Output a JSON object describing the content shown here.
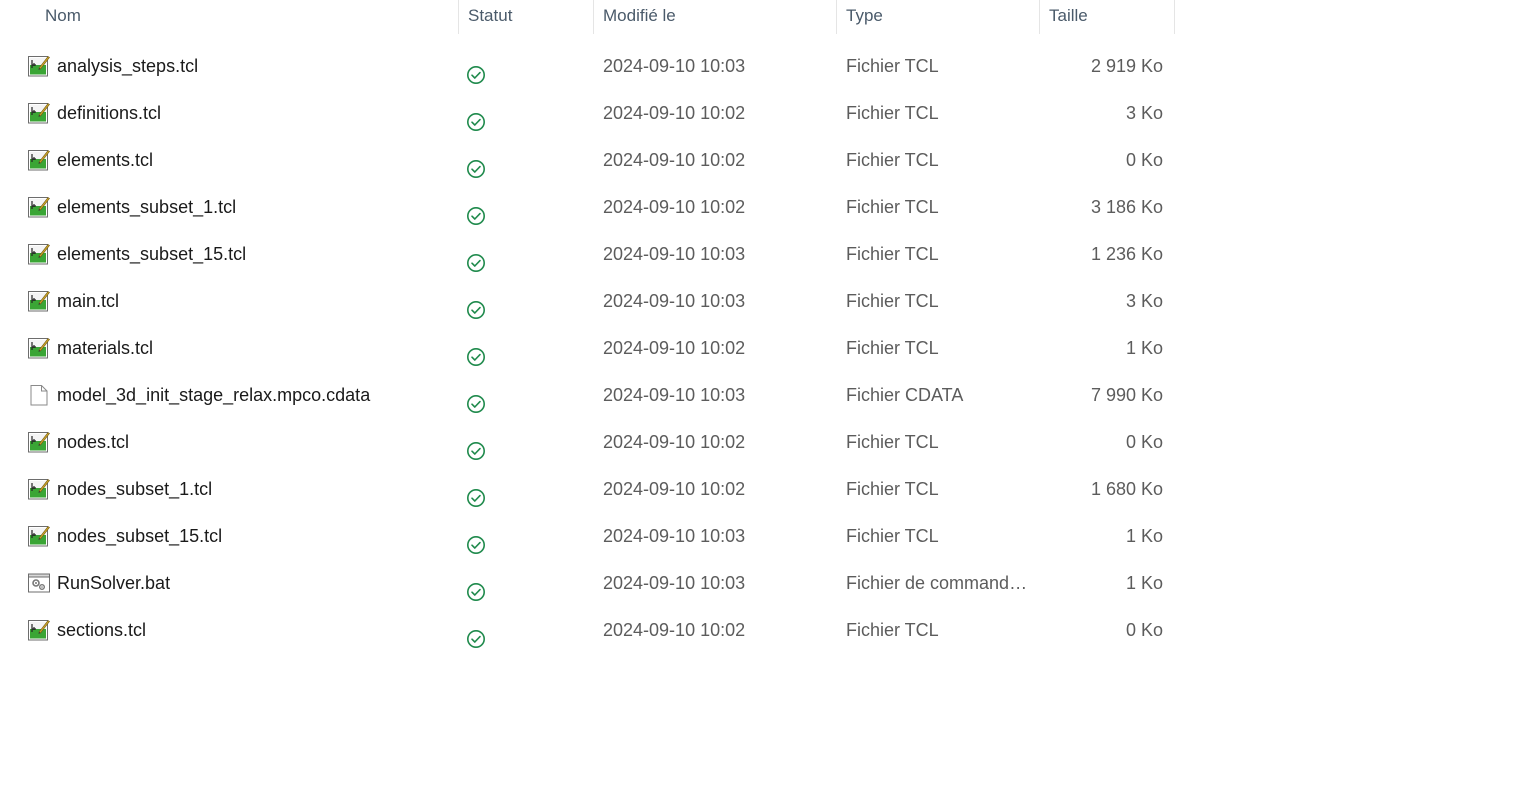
{
  "columns": {
    "name": "Nom",
    "status": "Statut",
    "modified": "Modifié le",
    "type": "Type",
    "size": "Taille"
  },
  "colors": {
    "sync_ok": "#1f8a4c",
    "tcl_icon_green": "#3aa535"
  },
  "files": [
    {
      "name": "analysis_steps.tcl",
      "icon": "tcl-file-icon",
      "status": "synced-icon",
      "modified": "2024-09-10 10:03",
      "type": "Fichier TCL",
      "size": "2 919 Ko"
    },
    {
      "name": "definitions.tcl",
      "icon": "tcl-file-icon",
      "status": "synced-icon",
      "modified": "2024-09-10 10:02",
      "type": "Fichier TCL",
      "size": "3 Ko"
    },
    {
      "name": "elements.tcl",
      "icon": "tcl-file-icon",
      "status": "synced-icon",
      "modified": "2024-09-10 10:02",
      "type": "Fichier TCL",
      "size": "0 Ko"
    },
    {
      "name": "elements_subset_1.tcl",
      "icon": "tcl-file-icon",
      "status": "synced-icon",
      "modified": "2024-09-10 10:02",
      "type": "Fichier TCL",
      "size": "3 186 Ko"
    },
    {
      "name": "elements_subset_15.tcl",
      "icon": "tcl-file-icon",
      "status": "synced-icon",
      "modified": "2024-09-10 10:03",
      "type": "Fichier TCL",
      "size": "1 236 Ko"
    },
    {
      "name": "main.tcl",
      "icon": "tcl-file-icon",
      "status": "synced-icon",
      "modified": "2024-09-10 10:03",
      "type": "Fichier TCL",
      "size": "3 Ko"
    },
    {
      "name": "materials.tcl",
      "icon": "tcl-file-icon",
      "status": "synced-icon",
      "modified": "2024-09-10 10:02",
      "type": "Fichier TCL",
      "size": "1 Ko"
    },
    {
      "name": "model_3d_init_stage_relax.mpco.cdata",
      "icon": "blank-file-icon",
      "status": "synced-icon",
      "modified": "2024-09-10 10:03",
      "type": "Fichier CDATA",
      "size": "7 990 Ko"
    },
    {
      "name": "nodes.tcl",
      "icon": "tcl-file-icon",
      "status": "synced-icon",
      "modified": "2024-09-10 10:02",
      "type": "Fichier TCL",
      "size": "0 Ko"
    },
    {
      "name": "nodes_subset_1.tcl",
      "icon": "tcl-file-icon",
      "status": "synced-icon",
      "modified": "2024-09-10 10:02",
      "type": "Fichier TCL",
      "size": "1 680 Ko"
    },
    {
      "name": "nodes_subset_15.tcl",
      "icon": "tcl-file-icon",
      "status": "synced-icon",
      "modified": "2024-09-10 10:03",
      "type": "Fichier TCL",
      "size": "1 Ko"
    },
    {
      "name": "RunSolver.bat",
      "icon": "batch-file-icon",
      "status": "synced-icon",
      "modified": "2024-09-10 10:03",
      "type": "Fichier de commande...",
      "size": "1 Ko"
    },
    {
      "name": "sections.tcl",
      "icon": "tcl-file-icon",
      "status": "synced-icon",
      "modified": "2024-09-10 10:02",
      "type": "Fichier TCL",
      "size": "0 Ko"
    }
  ]
}
